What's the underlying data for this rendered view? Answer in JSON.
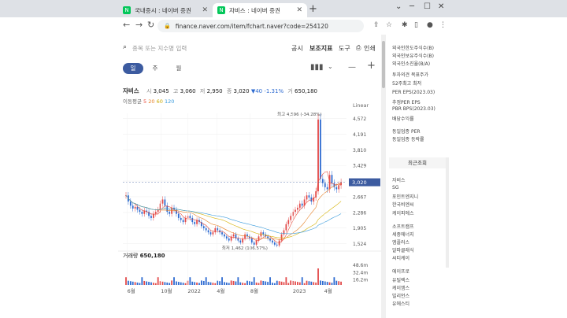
{
  "browser": {
    "tabs": [
      {
        "label": "국내증시 : 네이버 증권",
        "active": false
      },
      {
        "label": "자비스 : 네이버 증권",
        "active": true
      }
    ],
    "url": "finance.naver.com/item/fchart.naver?code=254120"
  },
  "search": {
    "placeholder": "종목 또는 지수명 입력"
  },
  "menu": [
    "공시",
    "보조지표",
    "도구"
  ],
  "print_label": "인쇄",
  "periods": [
    "일",
    "주",
    "월"
  ],
  "selected_period": "일",
  "stock": {
    "name": "자비스",
    "open_label": "시",
    "open": "3,045",
    "high_label": "고",
    "high": "3,060",
    "low_label": "저",
    "low": "2,950",
    "close_label": "종",
    "close": "3,020",
    "change": "▼40",
    "change_pct": "-1.31%",
    "volume_label": "거",
    "volume": "650,180"
  },
  "ma": {
    "label": "이동평균",
    "periods": [
      "5",
      "20",
      "60",
      "120"
    ],
    "colors": [
      "#e74c3c",
      "#e67e22",
      "#f1c40f",
      "#3498db"
    ]
  },
  "scale_label": "Linear",
  "volume_section": {
    "label": "거래량",
    "value": "650,180"
  },
  "right_panel": {
    "top_items": [
      "외국인한도주식수(B)",
      "외국인보유주식수(B)",
      "외국인소진율(B/A)",
      "투자의견 목표주가",
      "52주최고 최저",
      "PER EPS(2023.03)",
      "추정PER EPS",
      "PBR BPS(2023.03)",
      "배당수익률",
      "동일업종 PER",
      "동일업종 등락률"
    ],
    "recent_title": "최근조회",
    "recent_items": [
      "자비스",
      "SG",
      "포인트엔지니",
      "한국비엔씨",
      "케이피에스",
      "소프트캠프",
      "세중에너지",
      "엠플러스",
      "알파클래식",
      "씨티케이",
      "에이프로",
      "유틸렉스",
      "케이엠스",
      "빌리언스",
      "유에스티"
    ]
  },
  "chart_data": {
    "type": "candlestick",
    "x_tick_labels": [
      "6월",
      "10월",
      "2022",
      "4월",
      "8월",
      "2023",
      "4월"
    ],
    "y_tick_labels": [
      "4,572",
      "4,191",
      "3,810",
      "3,429",
      "3,048",
      "2,667",
      "2,286",
      "1,905",
      "1,524"
    ],
    "current_price": "3,020",
    "max_annotation": "최고 4,596 (-34.28%)",
    "min_annotation": "최저 1,462 (106.57%)",
    "volume_tick_labels": [
      "48.6m",
      "32.4m",
      "16.2m"
    ],
    "closes": [
      2700,
      2550,
      2450,
      2380,
      2420,
      2350,
      2300,
      2250,
      2330,
      2300,
      2200,
      2150,
      2250,
      2300,
      2350,
      2500,
      2600,
      2450,
      2300,
      2250,
      2400,
      2350,
      2250,
      2150,
      2100,
      2050,
      2150,
      2200,
      2150,
      2050,
      2000,
      2100,
      2050,
      1950,
      1900,
      1850,
      1800,
      1750,
      1800,
      1900,
      1850,
      1800,
      1750,
      1700,
      1650,
      1600,
      1700,
      1750,
      1650,
      1600,
      1550,
      1650,
      1750,
      1700,
      1650,
      1550,
      1500,
      1600,
      1700,
      1800,
      1750,
      1700,
      1650,
      1600,
      1550,
      1500,
      1480,
      1600,
      1750,
      1850,
      2000,
      2100,
      2200,
      2300,
      2350,
      2400,
      2500,
      2450,
      2600,
      2700,
      2650,
      2550,
      2650,
      2800,
      4550,
      3100,
      3000,
      2900,
      2850,
      3200,
      3000,
      2900,
      2850,
      2950,
      3020
    ]
  }
}
